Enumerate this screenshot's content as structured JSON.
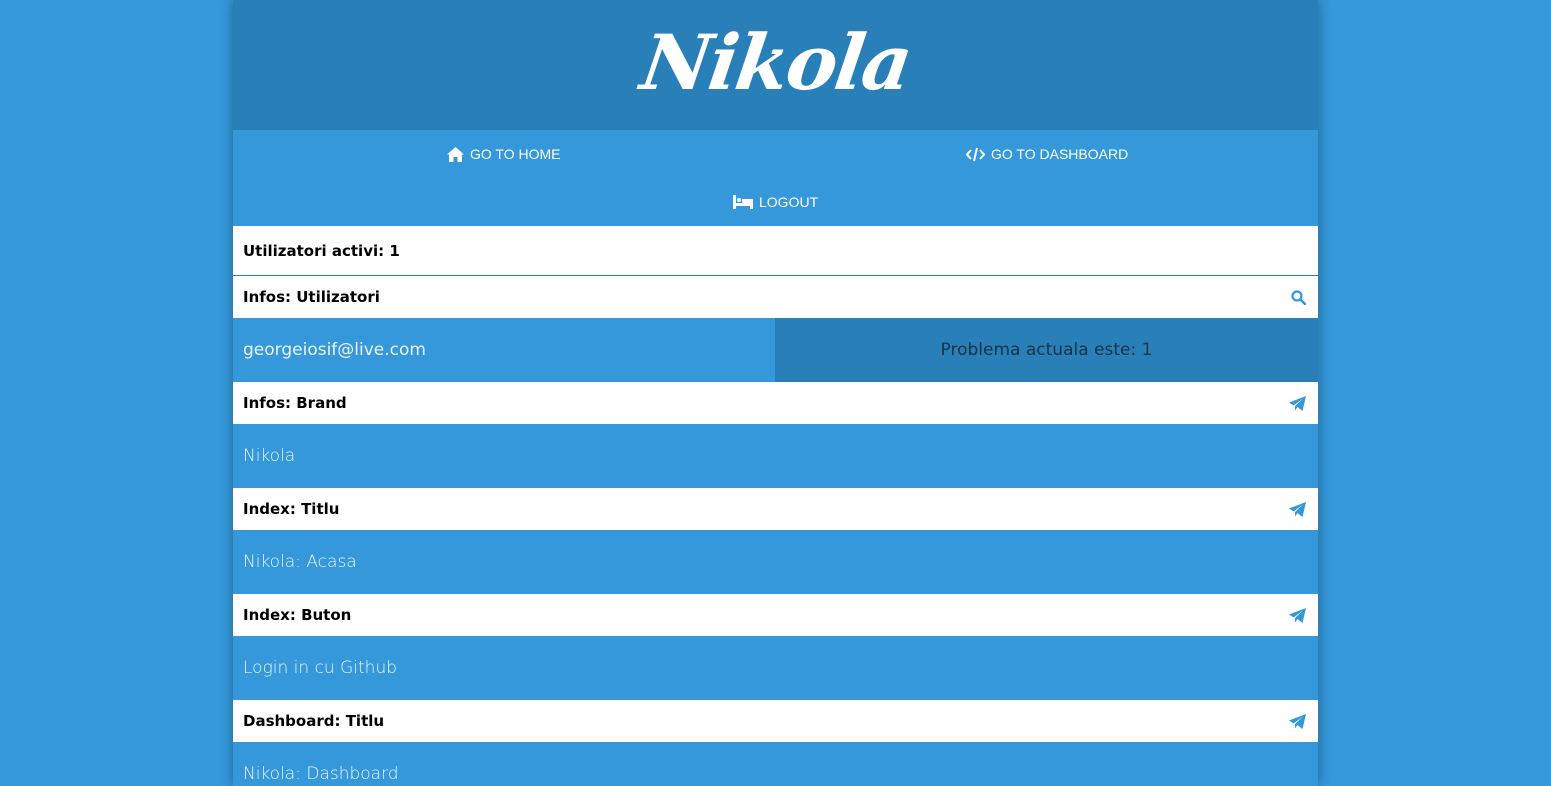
{
  "brand": {
    "logo_text": "Nikola"
  },
  "nav": {
    "home_label": "GO TO HOME",
    "home_icon": "home-icon",
    "dashboard_label": "GO TO DASHBOARD",
    "dashboard_icon": "code-icon",
    "logout_label": "LOGOUT",
    "logout_icon": "bed-icon"
  },
  "active_users": {
    "label": "Utilizatori activi: 1"
  },
  "users_section": {
    "header": "Infos: Utilizatori",
    "icon": "search-icon",
    "email": "georgeiosif@live.com",
    "problem": "Problema actuala este: 1"
  },
  "sections": [
    {
      "header": "Infos: Brand",
      "icon": "paper-plane-icon",
      "value": "Nikola"
    },
    {
      "header": "Index: Titlu",
      "icon": "paper-plane-icon",
      "value": "Nikola: Acasa"
    },
    {
      "header": "Index: Buton",
      "icon": "paper-plane-icon",
      "value": "Login in cu Github"
    },
    {
      "header": "Dashboard: Titlu",
      "icon": "paper-plane-icon",
      "value": "Nikola: Dashboard"
    }
  ],
  "colors": {
    "background": "#3498db",
    "brand_bar": "#2980b9",
    "header_bg": "#ffffff",
    "icon_accent": "#3498db"
  }
}
